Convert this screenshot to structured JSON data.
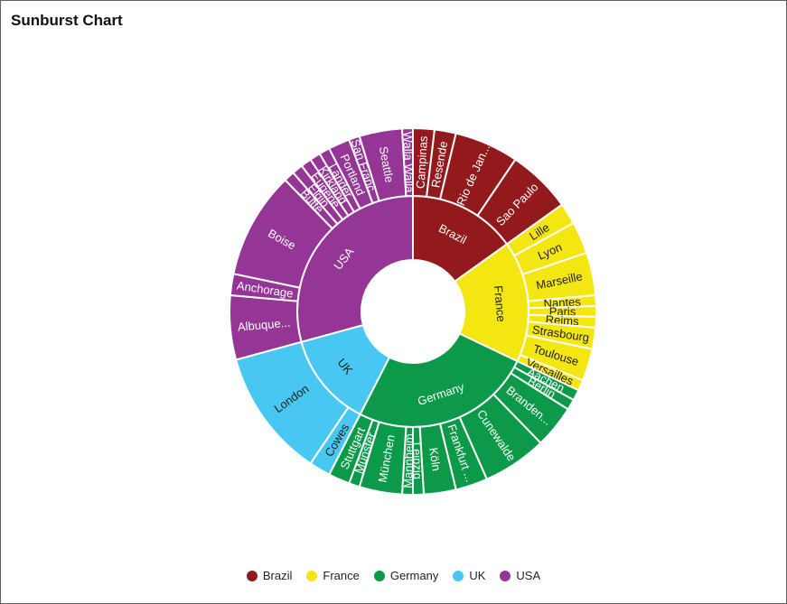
{
  "chart_data": {
    "type": "sunburst",
    "title": "Sunburst Chart",
    "legend_position": "bottom",
    "series": [
      {
        "name": "Brazil",
        "color": "#921a1d",
        "text_color": "#ffffff",
        "children": [
          {
            "name": "Campinas",
            "value": 2
          },
          {
            "name": "Resende",
            "value": 2
          },
          {
            "name": "Rio de Jan...",
            "value": 6
          },
          {
            "name": "Sao Paulo",
            "value": 6
          }
        ]
      },
      {
        "name": "France",
        "color": "#f4e711",
        "text_color": "#222222",
        "children": [
          {
            "name": "Lille",
            "value": 2
          },
          {
            "name": "Lyon",
            "value": 3
          },
          {
            "name": "Marseille",
            "value": 4
          },
          {
            "name": "Nantes",
            "value": 1
          },
          {
            "name": "Paris",
            "value": 1
          },
          {
            "name": "Reims",
            "value": 1
          },
          {
            "name": "Strasbourg",
            "value": 2
          },
          {
            "name": "Toulouse",
            "value": 3
          },
          {
            "name": "Versailles",
            "value": 1
          }
        ]
      },
      {
        "name": "Germany",
        "color": "#0c9949",
        "text_color": "#ffffff",
        "children": [
          {
            "name": "Aachen",
            "value": 1
          },
          {
            "name": "Berlin",
            "value": 1
          },
          {
            "name": "Branden...",
            "value": 4
          },
          {
            "name": "Cunewalde",
            "value": 6
          },
          {
            "name": "Frankfurt ...",
            "value": 3
          },
          {
            "name": "Köln",
            "value": 3
          },
          {
            "name": "Leipzig",
            "value": 1
          },
          {
            "name": "Mannheim",
            "value": 1
          },
          {
            "name": "München",
            "value": 4
          },
          {
            "name": "Münster",
            "value": 1
          },
          {
            "name": "Stuttgart",
            "value": 2
          }
        ]
      },
      {
        "name": "UK",
        "color": "#48c7f2",
        "text_color": "#222222",
        "children": [
          {
            "name": "Cowes",
            "value": 2
          },
          {
            "name": "London",
            "value": 12
          }
        ]
      },
      {
        "name": "USA",
        "color": "#953595",
        "text_color": "#ffffff",
        "children": [
          {
            "name": "Albuque...",
            "value": 6
          },
          {
            "name": "Anchorage",
            "value": 2
          },
          {
            "name": "Boise",
            "value": 10
          },
          {
            "name": "Butte",
            "value": 1
          },
          {
            "name": "Elgin",
            "value": 1
          },
          {
            "name": "Eugene",
            "value": 1
          },
          {
            "name": "Kirkland",
            "value": 1
          },
          {
            "name": "Lander",
            "value": 1
          },
          {
            "name": "Portland",
            "value": 2
          },
          {
            "name": "San Franc...",
            "value": 1
          },
          {
            "name": "Seattle",
            "value": 4
          },
          {
            "name": "Walla Walla",
            "value": 1
          }
        ]
      }
    ]
  }
}
